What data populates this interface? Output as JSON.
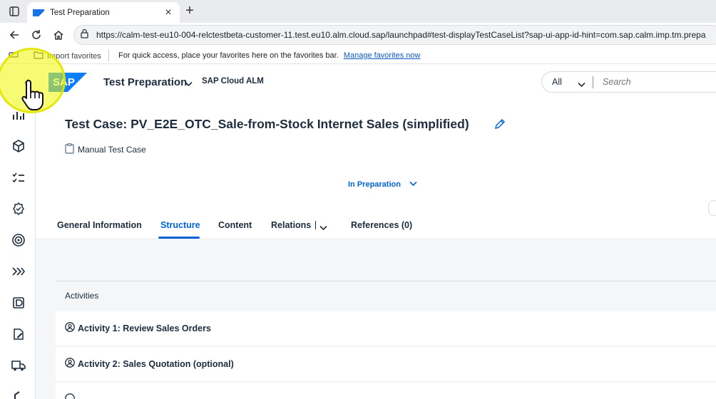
{
  "browser": {
    "tab_title": "Test Preparation",
    "url": "https://calm-test-eu10-004-relctestbeta-customer-11.test.eu10.alm.cloud.sap/launchpad#test-displayTestCaseList?sap-ui-app-id-hint=com.sap.calm.imp.tm.prepa"
  },
  "favorites_bar": {
    "import_label": "Import favorites",
    "message": "For quick access, place your favorites here on the favorites bar.",
    "manage_link": "Manage favorites now"
  },
  "shell": {
    "app_title": "Test Preparation",
    "product_name": "SAP Cloud ALM",
    "logo_text": "SAP",
    "search_scope": "All",
    "search_placeholder": "Search"
  },
  "object_header": {
    "title": "Test Case: PV_E2E_OTC_Sale-from-Stock Internet Sales (simplified)",
    "subtitle": "Manual Test Case",
    "status": "In Preparation"
  },
  "tabs": [
    {
      "label": "General Information"
    },
    {
      "label": "Structure"
    },
    {
      "label": "Content"
    },
    {
      "label": "Relations"
    },
    {
      "label": "References (0)"
    }
  ],
  "active_tab": "Structure",
  "activities": {
    "section_label": "Activities",
    "items": [
      {
        "label": "Activity 1: Review Sales Orders"
      },
      {
        "label": "Activity 2: Sales Quotation (optional)"
      }
    ]
  },
  "colors": {
    "accent": "#0064d9",
    "text": "#1d2d3e",
    "highlight": "#f0f500"
  }
}
